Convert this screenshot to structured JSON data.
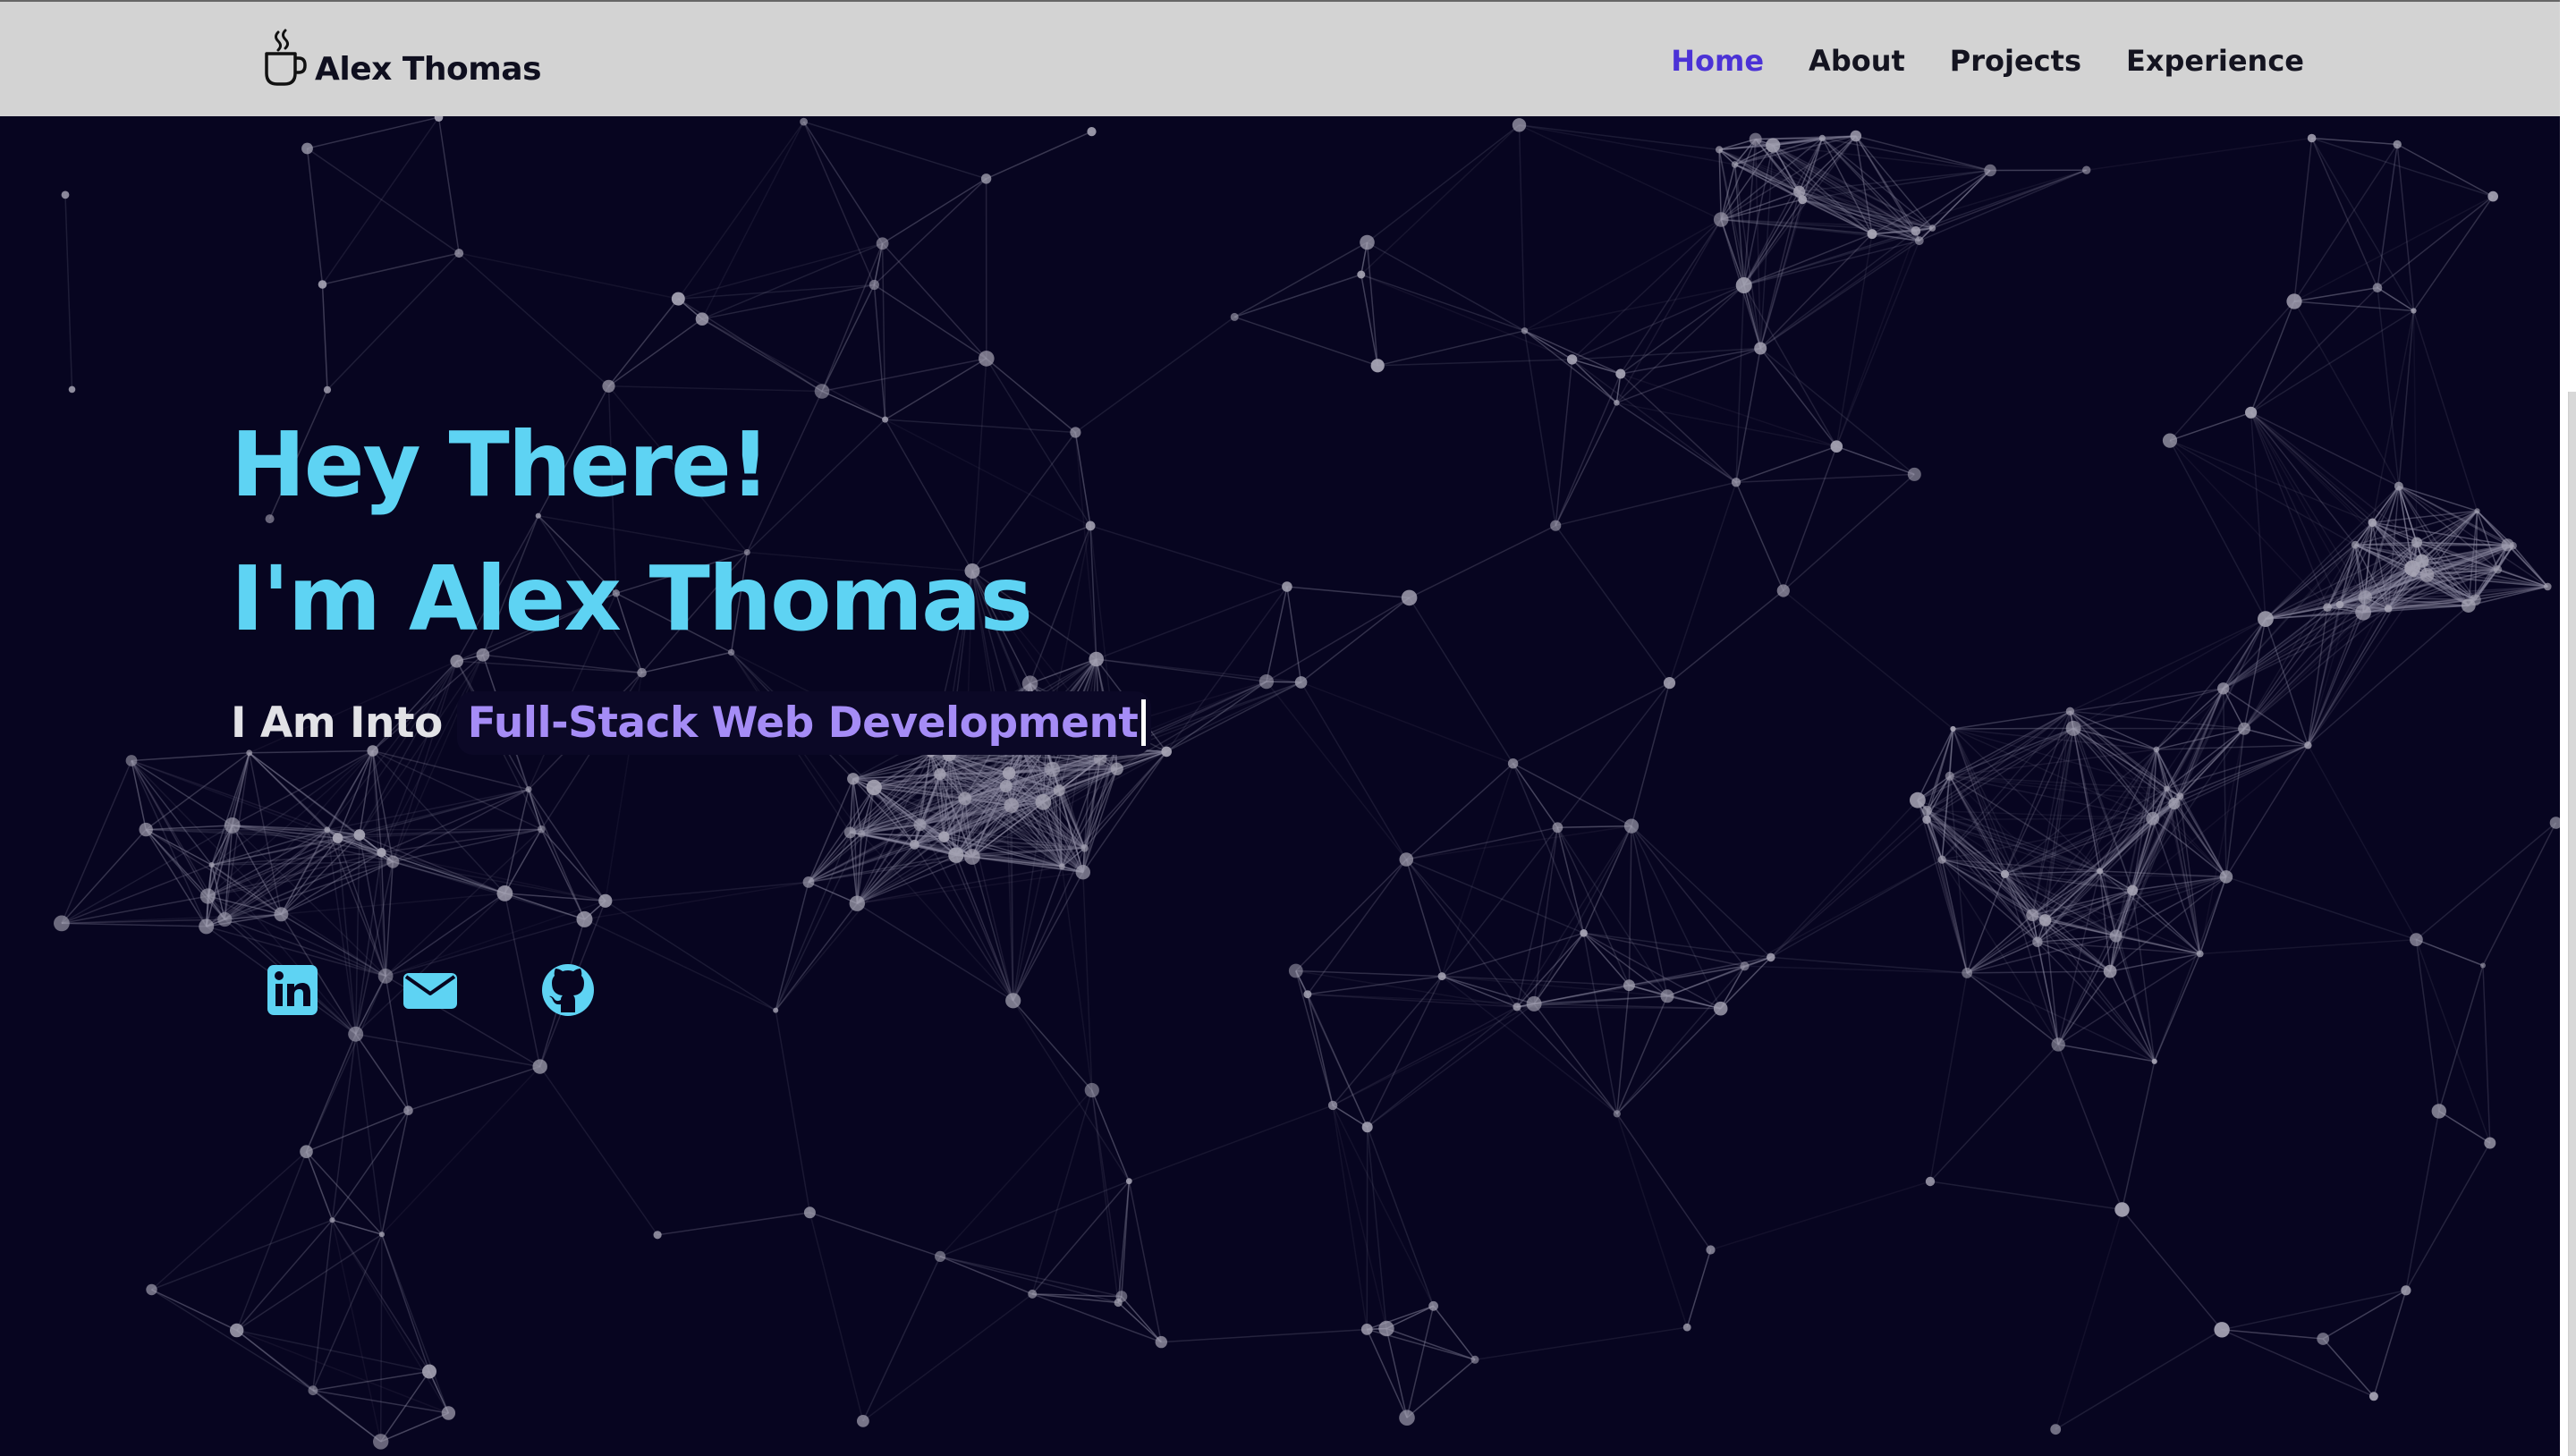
{
  "navbar": {
    "brand": {
      "icon": "coffee-cup-icon",
      "name": "Alex Thomas"
    },
    "links": [
      {
        "label": "Home",
        "active": true
      },
      {
        "label": "About",
        "active": false
      },
      {
        "label": "Projects",
        "active": false
      },
      {
        "label": "Experience",
        "active": false
      }
    ]
  },
  "hero": {
    "greeting": "Hey There!",
    "intro": "I'm Alex Thomas",
    "typing_prefix": "I Am Into ",
    "typing_text": "Full-Stack Web Development",
    "social_icons": [
      "linkedin-icon",
      "mail-icon",
      "github-icon"
    ]
  },
  "colors": {
    "navbar_bg": "#d3d3d3",
    "hero_bg": "#070520",
    "headline": "#5ed3f3",
    "typed_accent": "#a58cf6",
    "active_nav": "#4b32d6",
    "social_icon": "#5ed3f3",
    "network_nodes": "#9a98a8"
  }
}
